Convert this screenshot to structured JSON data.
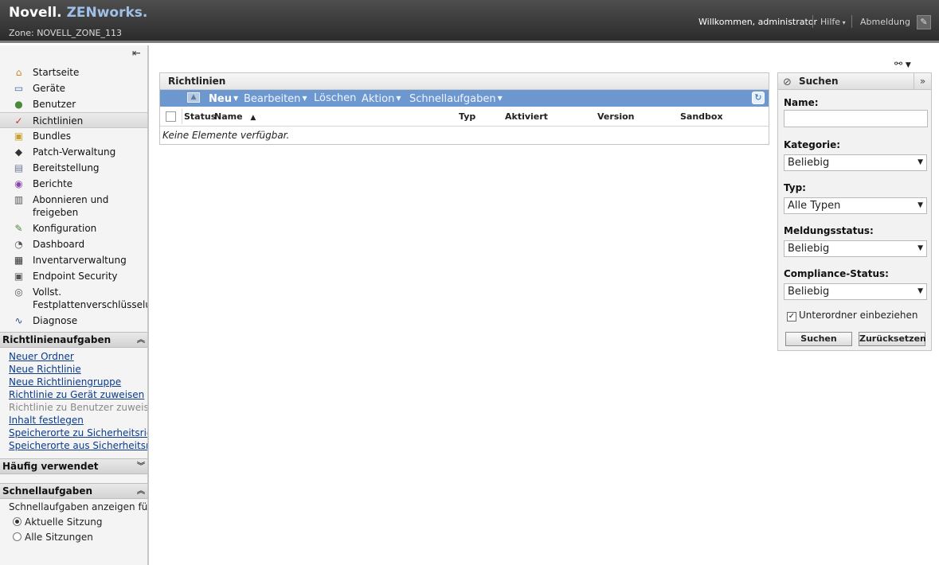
{
  "header": {
    "brand": "Novell.",
    "product": "ZENworks.",
    "zone": "Zone: NOVELL_ZONE_113",
    "welcome": "Willkommen, administrator",
    "help": "Hilfe",
    "logout": "Abmeldung"
  },
  "sidebar": {
    "items": [
      {
        "label": "Startseite",
        "icon": "home-icon"
      },
      {
        "label": "Geräte",
        "icon": "monitor-icon"
      },
      {
        "label": "Benutzer",
        "icon": "users-icon"
      },
      {
        "label": "Richtlinien",
        "icon": "policy-icon"
      },
      {
        "label": "Bundles",
        "icon": "bundle-icon"
      },
      {
        "label": "Patch-Verwaltung",
        "icon": "shield-icon"
      },
      {
        "label": "Bereitstellung",
        "icon": "deploy-icon"
      },
      {
        "label": "Berichte",
        "icon": "report-icon"
      },
      {
        "label": "Abonnieren und freigeben",
        "icon": "subscribe-icon"
      },
      {
        "label": "Konfiguration",
        "icon": "wrench-icon"
      },
      {
        "label": "Dashboard",
        "icon": "gauge-icon"
      },
      {
        "label": "Inventarverwaltung",
        "icon": "inventory-icon"
      },
      {
        "label": "Endpoint Security",
        "icon": "lock-icon"
      },
      {
        "label": "Vollst. Festplattenverschlüsselung",
        "icon": "disk-icon"
      },
      {
        "label": "Diagnose",
        "icon": "pulse-icon"
      }
    ],
    "active_index": 3,
    "tasks_panel": {
      "title": "Richtlinienaufgaben",
      "tasks": [
        {
          "label": "Neuer Ordner",
          "enabled": true
        },
        {
          "label": "Neue Richtlinie",
          "enabled": true
        },
        {
          "label": "Neue Richtliniengruppe",
          "enabled": true
        },
        {
          "label": "Richtlinie zu Gerät zuweisen",
          "enabled": true
        },
        {
          "label": "Richtlinie zu Benutzer zuweisen",
          "enabled": false
        },
        {
          "label": "Inhalt festlegen",
          "enabled": true
        },
        {
          "label": "Speicherorte zu Sicherheitsrichtlinie",
          "enabled": true
        },
        {
          "label": "Speicherorte aus Sicherheitsrichtlinie",
          "enabled": true
        }
      ]
    },
    "frequent_panel": {
      "title": "Häufig verwendet"
    },
    "quick_panel": {
      "title": "Schnellaufgaben",
      "label": "Schnellaufgaben anzeigen für:",
      "options": [
        "Aktuelle Sitzung",
        "Alle Sitzungen"
      ],
      "selected": "Aktuelle Sitzung"
    }
  },
  "main": {
    "title": "Richtlinien",
    "toolbar": {
      "new": "Neu",
      "edit": "Bearbeiten",
      "delete": "Löschen",
      "action": "Aktion",
      "quick_tasks": "Schnellaufgaben"
    },
    "columns": [
      "Status",
      "Name",
      "Typ",
      "Aktiviert",
      "Version",
      "Sandbox"
    ],
    "empty_message": "Keine Elemente verfügbar."
  },
  "search": {
    "title": "Suchen",
    "name_label": "Name:",
    "name_value": "",
    "category_label": "Kategorie:",
    "category_value": "Beliebig",
    "type_label": "Typ:",
    "type_value": "Alle Typen",
    "message_status_label": "Meldungsstatus:",
    "message_status_value": "Beliebig",
    "compliance_label": "Compliance-Status:",
    "compliance_value": "Beliebig",
    "include_subfolders_label": "Unterordner einbeziehen",
    "include_subfolders_checked": true,
    "search_button": "Suchen",
    "reset_button": "Zurücksetzen"
  }
}
